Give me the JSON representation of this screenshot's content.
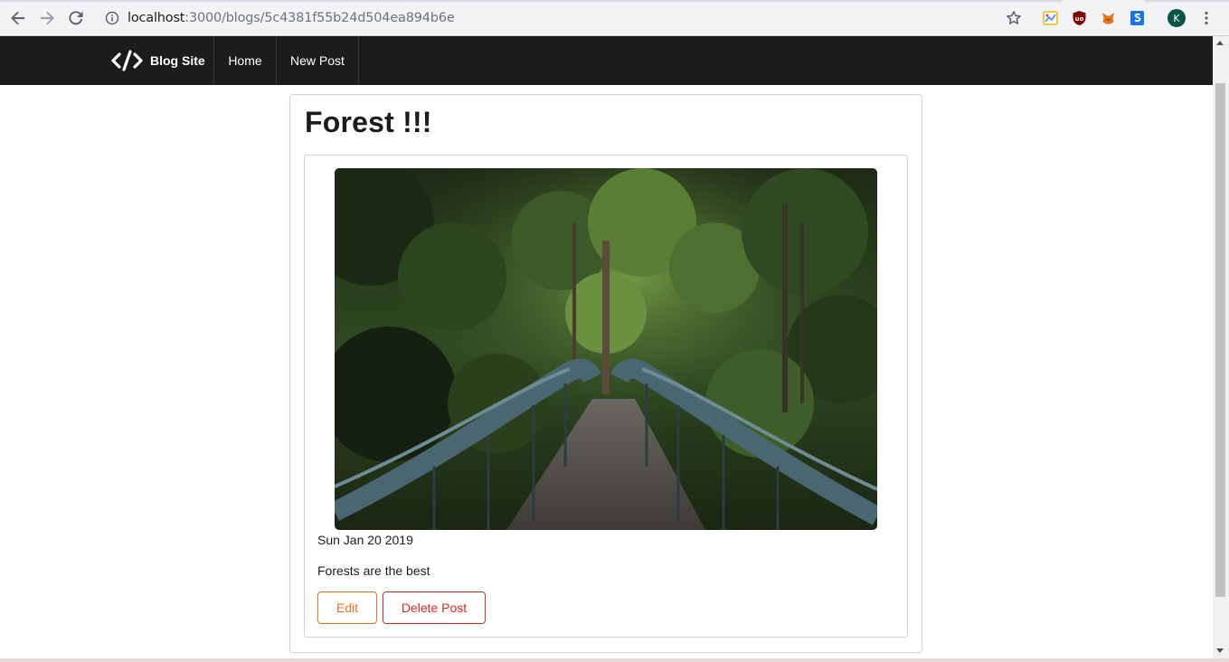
{
  "browser": {
    "url_host": "localhost",
    "url_path": ":3000/blogs/5c4381f55b24d504ea894b6e",
    "profile_initial": "K"
  },
  "navbar": {
    "brand": "Blog Site",
    "items": [
      {
        "label": "Home"
      },
      {
        "label": "New Post"
      }
    ]
  },
  "post": {
    "title": "Forest !!!",
    "date": "Sun Jan 20 2019",
    "body": "Forests are the best",
    "edit_label": "Edit",
    "delete_label": "Delete Post"
  },
  "colors": {
    "navbar_bg": "#1b1c1d",
    "edit_accent": "#f2711c",
    "delete_accent": "#db2828"
  }
}
